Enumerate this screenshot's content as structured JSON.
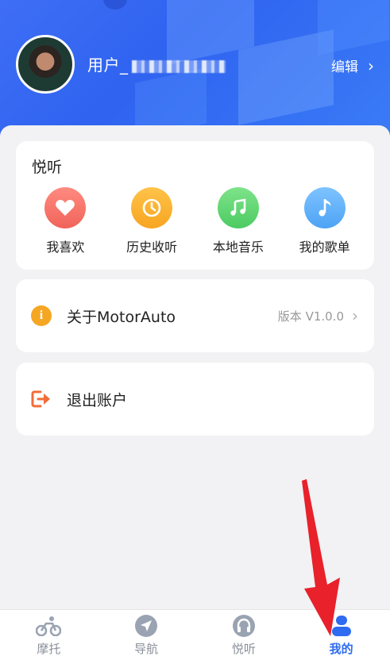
{
  "header": {
    "username_prefix": "用户_",
    "edit_label": "编辑",
    "chevron": "›"
  },
  "yueting_card": {
    "title": "悦听",
    "items": [
      {
        "label": "我喜欢",
        "icon": "heart-icon",
        "color": "#f0645a"
      },
      {
        "label": "历史收听",
        "icon": "clock-icon",
        "color": "#f7a520"
      },
      {
        "label": "本地音乐",
        "icon": "music-note-icon",
        "color": "#4ccb62"
      },
      {
        "label": "我的歌单",
        "icon": "single-note-icon",
        "color": "#4da3f5"
      }
    ]
  },
  "about": {
    "label": "关于MotorAuto",
    "version": "版本 V1.0.0",
    "icon": "info-icon",
    "chevron": "›"
  },
  "logout": {
    "label": "退出账户",
    "icon": "logout-icon"
  },
  "tabbar": {
    "tabs": [
      {
        "label": "摩托",
        "icon": "motorcycle-icon",
        "active": false
      },
      {
        "label": "导航",
        "icon": "navigation-icon",
        "active": false
      },
      {
        "label": "悦听",
        "icon": "headphones-icon",
        "active": false
      },
      {
        "label": "我的",
        "icon": "user-icon",
        "active": true
      }
    ]
  },
  "colors": {
    "header_blue": "#2f63f0",
    "active_tab": "#2f6bf0",
    "annotation_arrow": "#e8212b"
  }
}
